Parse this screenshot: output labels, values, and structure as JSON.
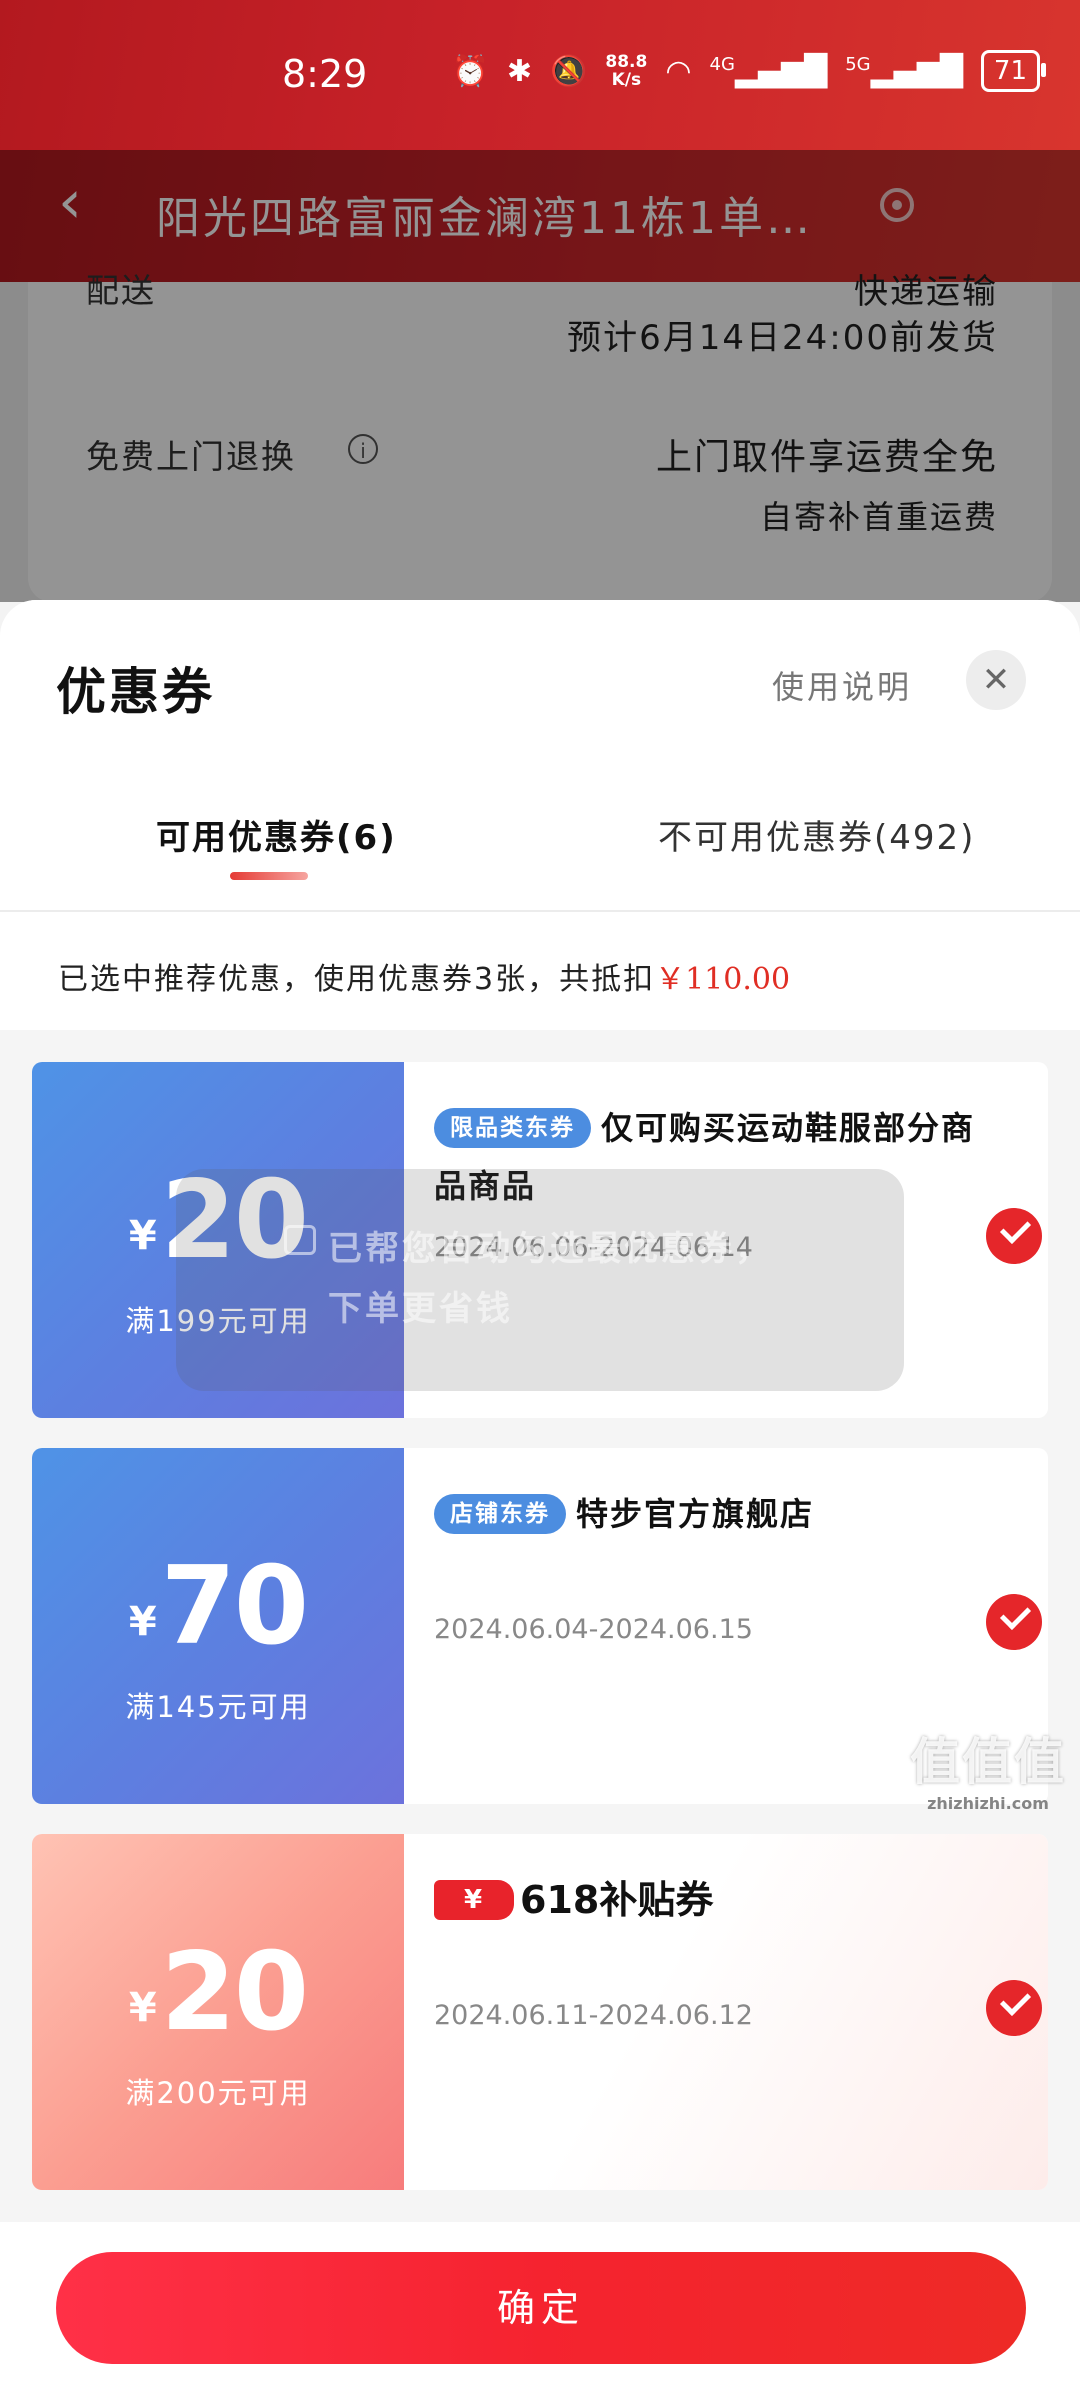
{
  "status_bar": {
    "time": "8:29",
    "net_speed_value": "88.8",
    "net_speed_unit": "K/s",
    "signal1_label": "4G",
    "signal2_label": "5G",
    "battery": "71"
  },
  "header": {
    "title": "阳光四路富丽金澜湾11栋1单…"
  },
  "background_page": {
    "delivery_label": "配送",
    "delivery_value": "快递运输",
    "delivery_estimate": "预计6月14日24:00前发货",
    "return_label": "免费上门退换",
    "return_value": "上门取件享运费全免",
    "return_sub": "自寄补首重运费"
  },
  "sheet": {
    "title": "优惠券",
    "usage_link": "使用说明",
    "close_symbol": "✕",
    "tabs": [
      {
        "label": "可用优惠券(6)",
        "active": true
      },
      {
        "label": "不可用优惠券(492)",
        "active": false
      }
    ],
    "summary_prefix": "已选中推荐优惠，使用优惠券3张，共抵扣",
    "summary_amount": "￥110.00"
  },
  "coupons": [
    {
      "currency": "¥",
      "amount": "20",
      "threshold": "满199元可用",
      "tag": "限品类东券",
      "title": "仅可购买运动鞋服部分商品商品",
      "validity": "2024.06.06-2024.06.14",
      "selected": true,
      "theme": "blue"
    },
    {
      "currency": "¥",
      "amount": "70",
      "threshold": "满145元可用",
      "tag": "店铺东券",
      "title": "特步官方旗舰店",
      "validity": "2024.06.04-2024.06.15",
      "selected": true,
      "theme": "blue"
    },
    {
      "currency": "¥",
      "amount": "20",
      "threshold": "满200元可用",
      "badge_symbol": "¥",
      "title": "618补贴券",
      "validity": "2024.06.11-2024.06.12",
      "selected": true,
      "theme": "pink"
    }
  ],
  "toast": {
    "text": "已帮您自动勾选最优惠券，下单更省钱"
  },
  "footer": {
    "confirm_label": "确定"
  },
  "watermark": {
    "main": "值值值",
    "sub": "zhizhizhi.com"
  },
  "colors": {
    "brand_red": "#e5262a",
    "coupon_blue": "#4f93e6",
    "coupon_pink": "#fb9e91"
  }
}
